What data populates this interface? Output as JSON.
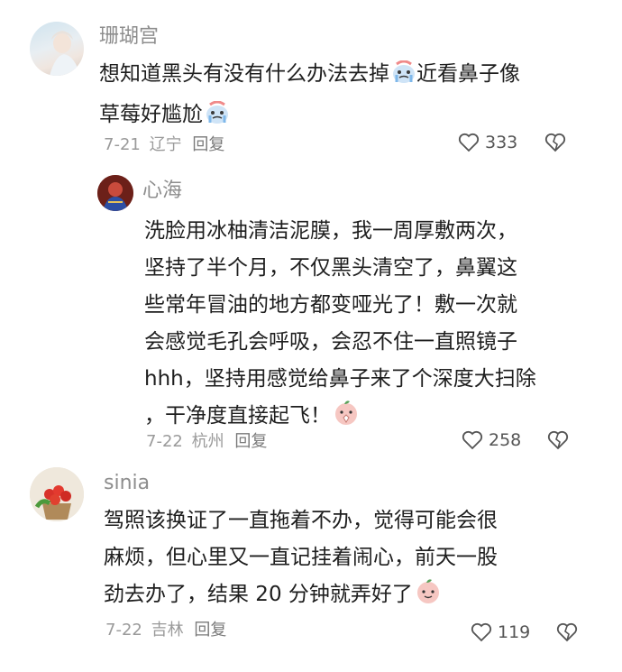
{
  "comments": [
    {
      "username": "珊瑚宫",
      "text": "想知道黑头有没有什么办法去掉",
      "text2": "近看鼻子像",
      "text3": "草莓好尴尬",
      "date": "7-21",
      "location": "辽宁",
      "reply_label": "回复",
      "likes": "333",
      "emoji_names": [
        "crying-face-icon"
      ]
    },
    {
      "username": "心海",
      "lines": [
        "洗脸用冰柚清洁泥膜，我一周厚敷两次，",
        "坚持了半个月，不仅黑头清空了，鼻翼这",
        "些常年冒油的地方都变哑光了！敷一次就",
        "会感觉毛孔会呼吸，会忍不住一直照镜子",
        "hhh，坚持用感觉给鼻子来了个深度大扫除",
        "，干净度直接起飞！"
      ],
      "date": "7-22",
      "location": "杭州",
      "reply_label": "回复",
      "likes": "258",
      "emoji_names": [
        "peach-praying-icon"
      ]
    },
    {
      "username": "sinia",
      "lines": [
        "驾照该换证了一直拖着不办，觉得可能会很",
        "麻烦，但心里又一直记挂着闹心，前天一股",
        "劲去办了，结果 20 分钟就弄好了"
      ],
      "date": "7-22",
      "location": "吉林",
      "reply_label": "回复",
      "likes": "119",
      "emoji_names": [
        "peach-smile-icon"
      ]
    }
  ]
}
